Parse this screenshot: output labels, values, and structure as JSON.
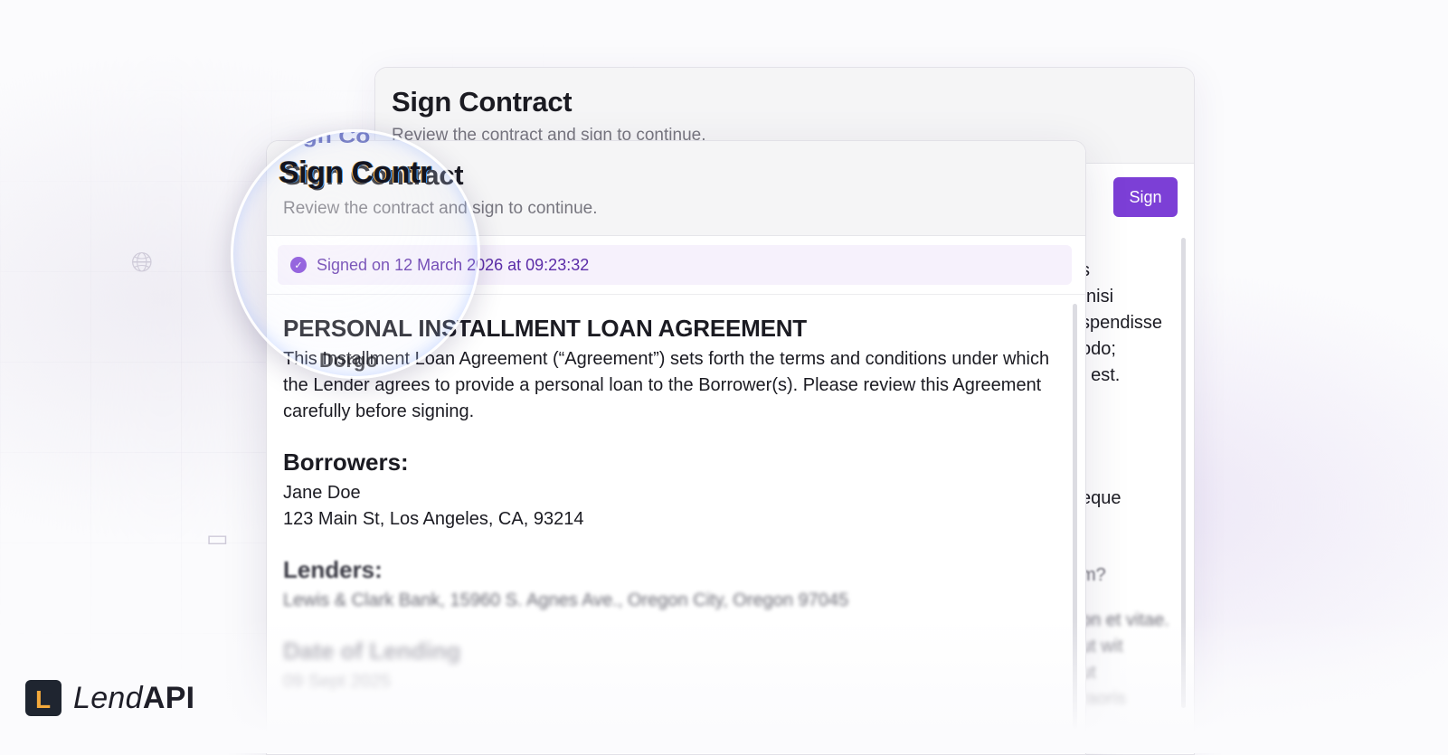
{
  "back_card": {
    "title": "Sign Contract",
    "subtitle": "Review the contract and sign to continue.",
    "sign_label": "Sign",
    "fragments": [
      "s",
      "nisi",
      "spendisse",
      "odo;",
      ". est.",
      "eque",
      "m?",
      "on et vitae.",
      "ut wit",
      "ut",
      "raoris"
    ]
  },
  "front_card": {
    "title": "Sign Contract",
    "subtitle": "Review the contract and sign to continue.",
    "signed_text": "Signed on 12 March 2026 at 09:23:32",
    "doc": {
      "heading": "PERSONAL INSTALLMENT LOAN AGREEMENT",
      "intro": "This Installment Loan Agreement (“Agreement”) sets forth the terms and conditions under which the Lender agrees to provide a personal loan to the Borrower(s). Please review this Agreement carefully before signing.",
      "borrowers_heading": "Borrowers:",
      "borrower_name": "Jane Doe",
      "borrower_address": "123 Main St, Los Angeles, CA, 93214",
      "lenders_heading": "Lenders:",
      "lender_detail": "Lewis & Clark Bank, 15960 S. Agnes Ave., Oregon City, Oregon 97045",
      "date_heading": "Date of Lending",
      "date_value": "09 Sept 2025"
    }
  },
  "lens": {
    "title": "Sign Contr",
    "arc": "Sign Co",
    "bottom": "Dorgo"
  },
  "logo": {
    "mark": "L",
    "name_light": "Lend",
    "name_bold": "API"
  },
  "colors": {
    "accent": "#7c3fd6",
    "signed_bg": "#f6f1fc",
    "signed_text": "#5b2ca8"
  }
}
